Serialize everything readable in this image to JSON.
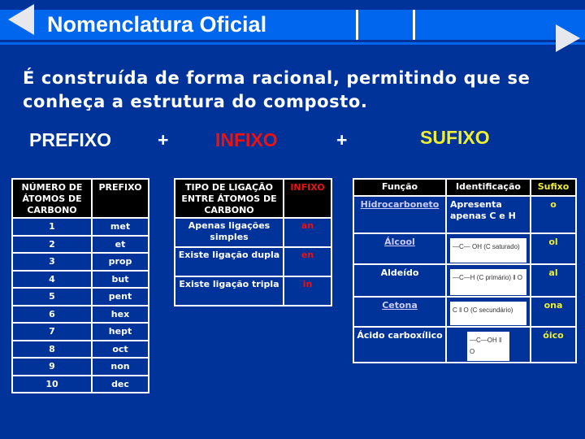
{
  "header": {
    "title": "Nomenclatura Oficial",
    "prev_icon": "triangle-left-icon",
    "next_icon": "triangle-right-icon"
  },
  "intro_text": "É construída de forma racional, permitindo que se conheça a estrutura do composto.",
  "formula_parts": {
    "prefix": "PREFIXO",
    "plus1": "+",
    "infix": "INFIXO",
    "plus2": "+",
    "suffix": "SUFIXO"
  },
  "colors": {
    "background": "#003399",
    "title_bar": "#0066ee",
    "infix": "#ee1111",
    "suffix": "#eeee33"
  },
  "prefix_table": {
    "headers": [
      "NÚMERO DE ÁTOMOS DE CARBONO",
      "PREFIXO"
    ],
    "rows": [
      [
        "1",
        "met"
      ],
      [
        "2",
        "et"
      ],
      [
        "3",
        "prop"
      ],
      [
        "4",
        "but"
      ],
      [
        "5",
        "pent"
      ],
      [
        "6",
        "hex"
      ],
      [
        "7",
        "hept"
      ],
      [
        "8",
        "oct"
      ],
      [
        "9",
        "non"
      ],
      [
        "10",
        "dec"
      ]
    ]
  },
  "infix_table": {
    "headers": [
      "TIPO DE LIGAÇÃO ENTRE ÁTOMOS DE CARBONO",
      "INFIXO"
    ],
    "rows": [
      [
        "Apenas ligações simples",
        "an"
      ],
      [
        "Existe ligação dupla",
        "en"
      ],
      [
        "Existe ligação tripla",
        "in"
      ]
    ]
  },
  "suffix_table": {
    "headers": [
      "Função",
      "Identificação",
      "Sufixo"
    ],
    "rows": [
      {
        "funcao": "Hidrocarboneto",
        "link": true,
        "identificacao": "Apresenta apenas C e H",
        "formula": null,
        "sufixo": "o"
      },
      {
        "funcao": "Álcool",
        "link": true,
        "identificacao": null,
        "formula": "—C— OH (C saturado)",
        "sufixo": "ol"
      },
      {
        "funcao": "Aldeído",
        "link": false,
        "identificacao": null,
        "formula": "—C—H (C primário) ‖ O",
        "sufixo": "al"
      },
      {
        "funcao": "Cetona",
        "link": true,
        "identificacao": null,
        "formula": "C ‖ O (C secundário)",
        "sufixo": "ona"
      },
      {
        "funcao": "Ácido carboxílico",
        "link": false,
        "identificacao": null,
        "formula": "—C—OH ‖ O",
        "sufixo": "óico"
      }
    ]
  }
}
